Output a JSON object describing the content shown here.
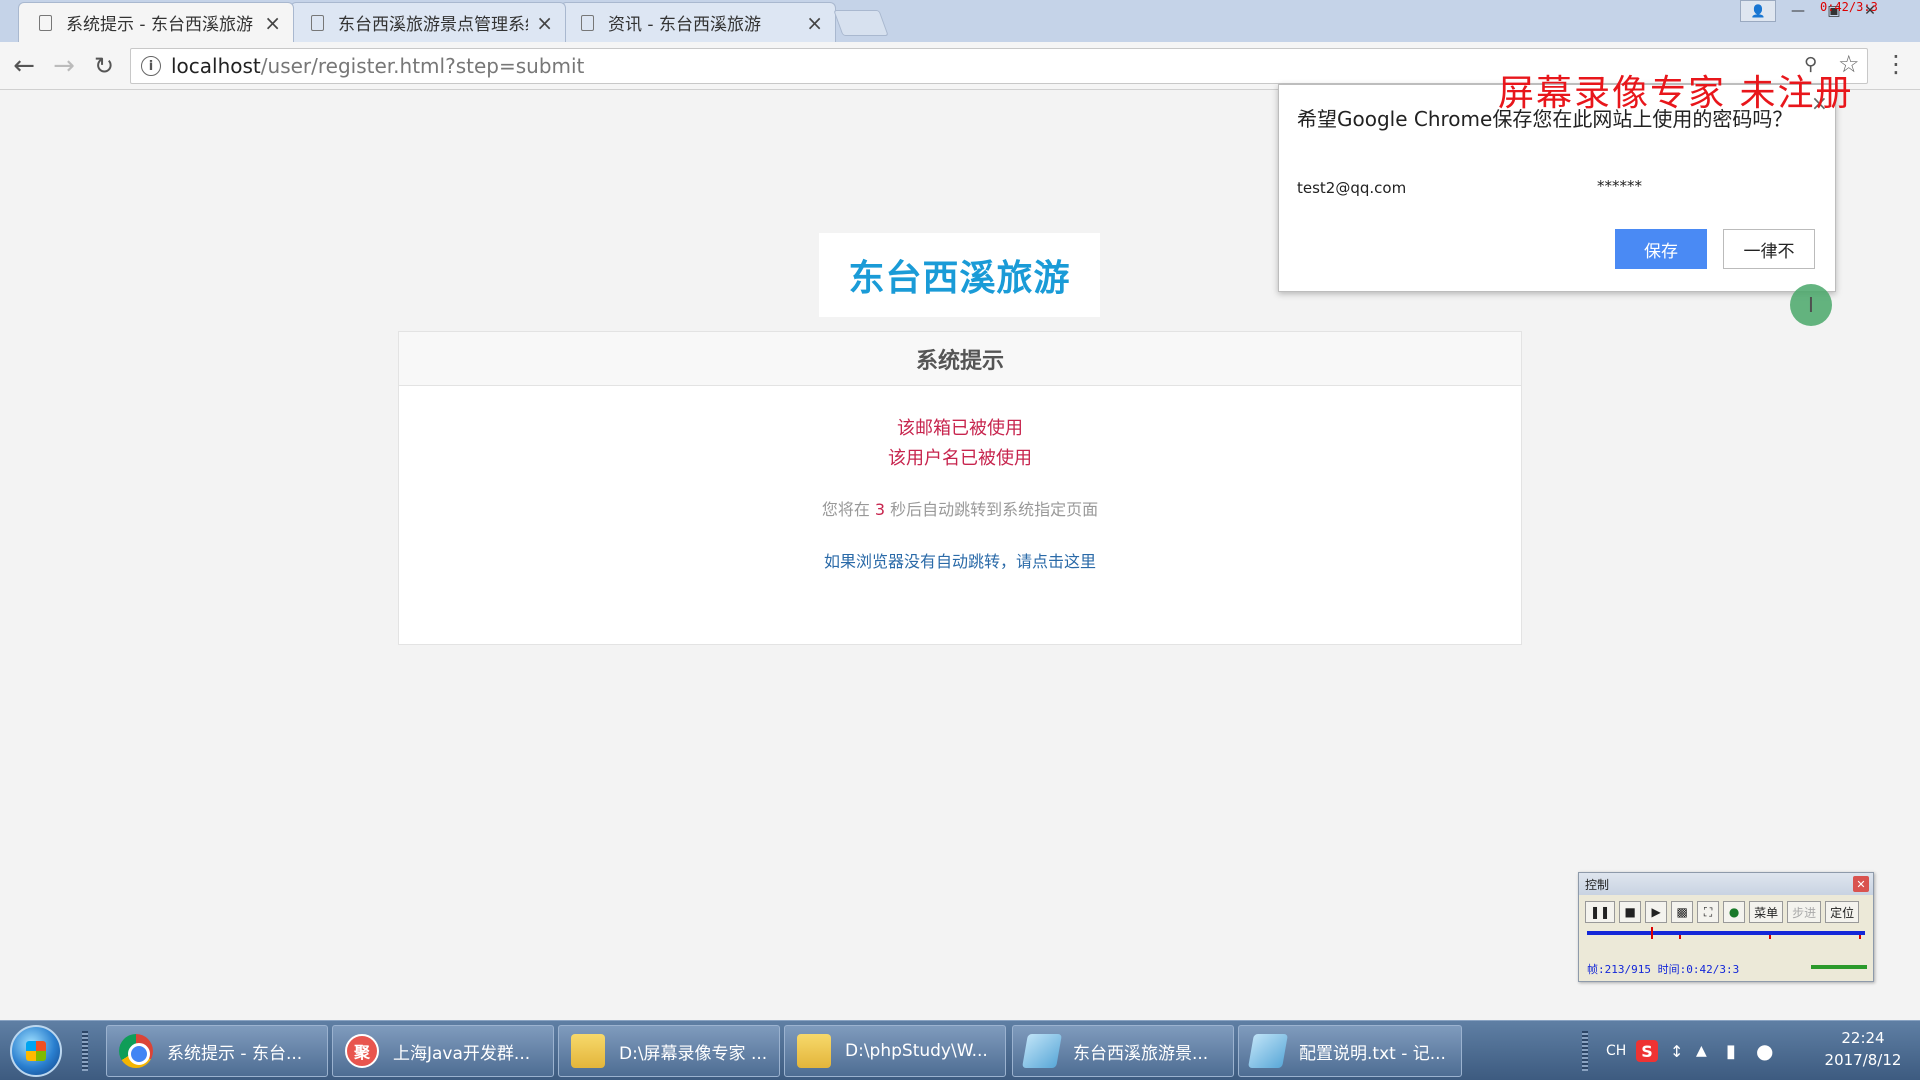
{
  "browser": {
    "tabs": [
      {
        "title": "系统提示 - 东台西溪旅游",
        "active": true
      },
      {
        "title": "东台西溪旅游景点管理系统",
        "active": false
      },
      {
        "title": "资讯 - 东台西溪旅游",
        "active": false
      }
    ],
    "url_host": "localhost",
    "url_path": "/user/register.html?step=submit",
    "recording_time": "0:42/3:3"
  },
  "page": {
    "logo": "东台西溪旅游",
    "panel_title": "系统提示",
    "errors": [
      "该邮箱已被使用",
      "该用户名已被使用"
    ],
    "countdown_prefix": "您将在 ",
    "countdown_seconds": "3",
    "countdown_suffix": " 秒后自动跳转到系统指定页面",
    "redirect_link": "如果浏览器没有自动跳转，请点击这里"
  },
  "password_prompt": {
    "question": "希望Google Chrome保存您在此网站上使用的密码吗？",
    "username": "test2@qq.com",
    "password_mask": "******",
    "save_label": "保存",
    "never_label": "一律不"
  },
  "watermark": "屏幕录像专家  未注册",
  "recorder": {
    "title": "控制",
    "menu_label": "菜单",
    "step_label": "步进",
    "locate_label": "定位",
    "info": "帧:213/915 时间:0:42/3:3"
  },
  "taskbar": {
    "items": [
      {
        "label": "系统提示 - 东台...",
        "icon": "chrome-icon"
      },
      {
        "label": "上海Java开发群...",
        "icon": "chat-icon"
      },
      {
        "label": "D:\\屏幕录像专家 ...",
        "icon": "folder-icon"
      },
      {
        "label": "D:\\phpStudy\\W...",
        "icon": "folder-icon"
      },
      {
        "label": "东台西溪旅游景...",
        "icon": "notepad-icon"
      },
      {
        "label": "配置说明.txt - 记...",
        "icon": "notepad-icon"
      }
    ],
    "ime": "CH",
    "time": "22:24",
    "date": "2017/8/12"
  },
  "colors": {
    "accent": "#1a9bd7",
    "error": "#c7254e",
    "link": "#2a6aa8",
    "save_button": "#4a8af4",
    "watermark": "#e8161b"
  }
}
